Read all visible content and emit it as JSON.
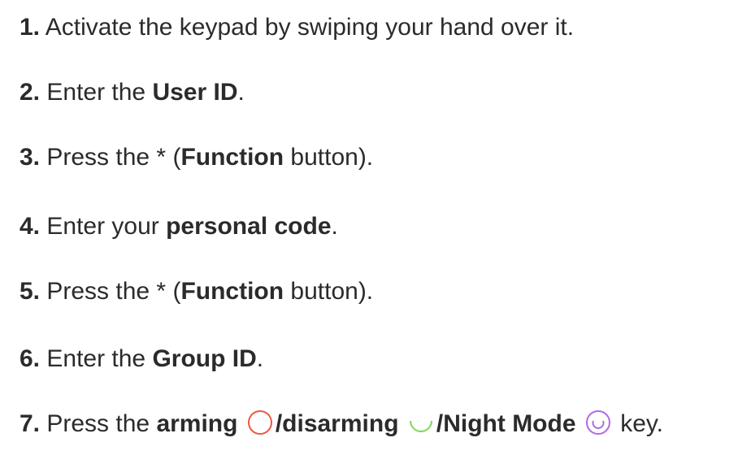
{
  "steps": [
    {
      "number": "1.",
      "text": "Activate the keypad by swiping your hand over it."
    },
    {
      "number": "2.",
      "pre": "Enter the ",
      "bold": "User ID",
      "post": "."
    },
    {
      "number": "3.",
      "pre": "Press the * (",
      "bold": "Function",
      "post": " button)."
    },
    {
      "number": "4.",
      "pre": "Enter your ",
      "bold": "personal code",
      "post": "."
    },
    {
      "number": "5.",
      "pre": "Press the * (",
      "bold": "Function",
      "post": " button)."
    },
    {
      "number": "6.",
      "pre": "Enter the ",
      "bold": "Group ID",
      "post": "."
    },
    {
      "number": "7.",
      "pre": "Press the ",
      "arming": "arming",
      "sep1": "/",
      "disarming": "disarming",
      "sep2": "/",
      "night": "Night Mode",
      "post": " key."
    }
  ],
  "icons": {
    "arming": {
      "name": "arming-icon",
      "color": "#f0553f"
    },
    "disarming": {
      "name": "disarming-icon",
      "color": "#7ed957"
    },
    "night": {
      "name": "night-mode-icon",
      "color": "#b06ae0"
    }
  }
}
